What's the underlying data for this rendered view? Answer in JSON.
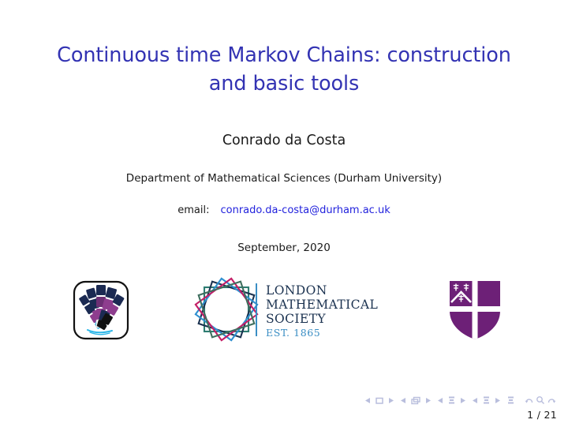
{
  "slide": {
    "title_lines": [
      "Continuous time Markov Chains:  construction",
      "and basic tools"
    ],
    "author": "Conrado da Costa",
    "affiliation": "Department of Mathematical Sciences (Durham University)",
    "email_label": "email:",
    "email_address": "conrado.da-costa@durham.ac.uk",
    "date": "September, 2020"
  },
  "logos": [
    {
      "name": "fan-badge-logo",
      "alt": "rounded square badge with fanned tile pattern",
      "colors": [
        "#1b2a52",
        "#8e3d8e",
        "#7d2f7d",
        "#000000",
        "#2bb6e8"
      ]
    },
    {
      "name": "london-mathematical-society-logo",
      "line1": "LONDON",
      "line2": "MATHEMATICAL",
      "line3": "SOCIETY",
      "established": "EST. 1865",
      "text_color": "#1b3250",
      "est_color": "#3a8ec4",
      "star_colors": [
        "#2e7d72",
        "#1b3250",
        "#2f8fd0",
        "#c41e66",
        "#3f6e5e"
      ]
    },
    {
      "name": "durham-university-shield-logo",
      "alt": "purple quartered shield with white cross",
      "color": "#6d2077"
    }
  ],
  "navigation": {
    "controls": [
      {
        "name": "first-frame",
        "glyph": "◀"
      },
      {
        "name": "previous-frame",
        "glyph": "□"
      },
      {
        "name": "next-frame",
        "glyph": "▶"
      },
      {
        "name": "previous-slide",
        "glyph": "◀"
      },
      {
        "name": "slide-stack",
        "glyph": "⧉"
      },
      {
        "name": "next-slide",
        "glyph": "▶"
      },
      {
        "name": "previous-subsection",
        "glyph": "◀"
      },
      {
        "name": "subsection-marker",
        "glyph": "≣"
      },
      {
        "name": "next-subsection",
        "glyph": "▶"
      },
      {
        "name": "previous-section",
        "glyph": "◀"
      },
      {
        "name": "section-marker",
        "glyph": "≣"
      },
      {
        "name": "next-section",
        "glyph": "▶"
      },
      {
        "name": "document-marker",
        "glyph": "≣"
      },
      {
        "name": "back",
        "glyph": "↶"
      },
      {
        "name": "search",
        "glyph": "⚲"
      },
      {
        "name": "forward",
        "glyph": "↷"
      }
    ],
    "page_counter": "1 / 21",
    "icon_color": "#b9bedd"
  }
}
